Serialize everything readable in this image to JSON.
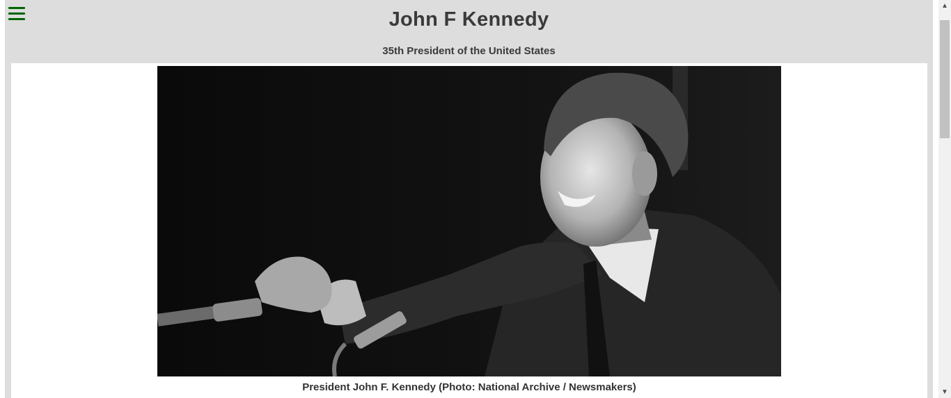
{
  "header": {
    "menu_icon": "hamburger-menu-icon",
    "title": "John F Kennedy",
    "subtitle": "35th President of the United States"
  },
  "main": {
    "photo_alt": "President John F. Kennedy",
    "caption": "President John F. Kennedy (Photo: National Archive / Newsmakers)"
  },
  "colors": {
    "page_background": "#dddddd",
    "menu_icon": "#006400",
    "title_text": "#3a3a3a"
  }
}
